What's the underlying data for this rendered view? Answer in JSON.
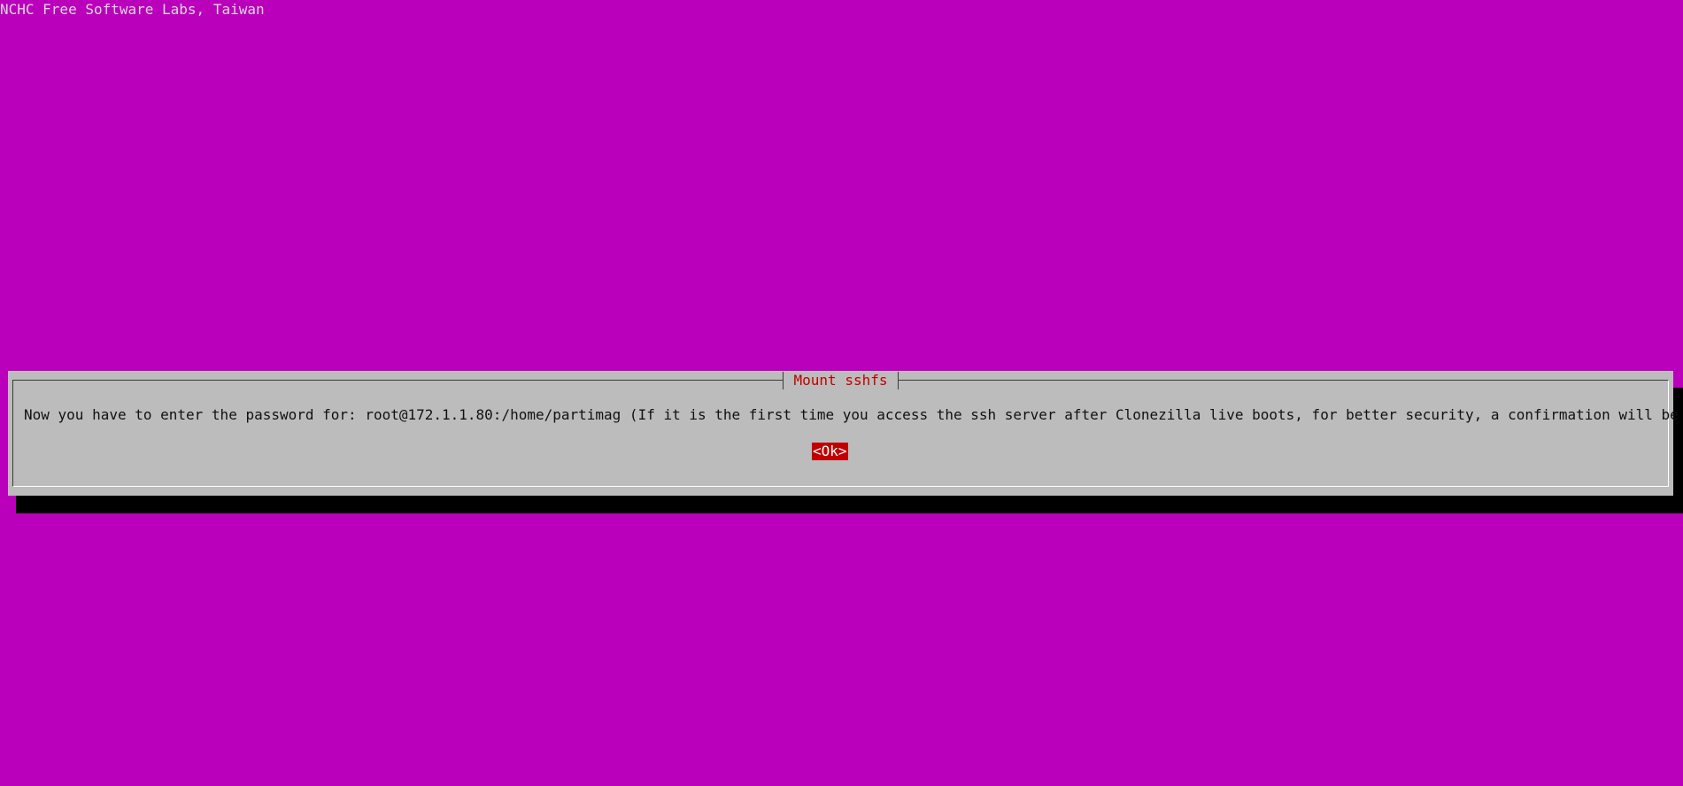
{
  "backtitle": "NCHC Free Software Labs, Taiwan",
  "dialog": {
    "title": "Mount sshfs",
    "message": "Now you have to enter the password for: root@172.1.1.80:/home/partimag (If it is the first time you access the ssh server after Clonezilla live boots, for better security, a confirmation will be asked)",
    "ok_label": "<Ok>"
  },
  "colors": {
    "background": "#bb00bb",
    "dialog": "#bcbcbc",
    "title_text": "#c00000",
    "button_highlight": "#c00000",
    "shadow": "#000000"
  }
}
